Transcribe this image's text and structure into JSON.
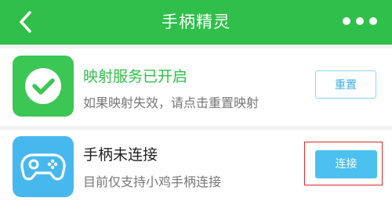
{
  "header": {
    "title": "手柄精灵",
    "back_icon": "chevron-left-icon",
    "more_icon": "more-dots-icon",
    "background_color": "#2fbf4a"
  },
  "cards": {
    "service": {
      "icon": "check-circle-icon",
      "title": "映射服务已开启",
      "subtitle": "如果映射失效，请点击重置映射",
      "button_label": "重置",
      "accent_color": "#3cc653"
    },
    "gamepad": {
      "icon": "gamepad-icon",
      "title": "手柄未连接",
      "subtitle": "目前仅支持小鸡手柄连接",
      "button_label": "连接",
      "accent_color": "#47b8ee"
    }
  }
}
